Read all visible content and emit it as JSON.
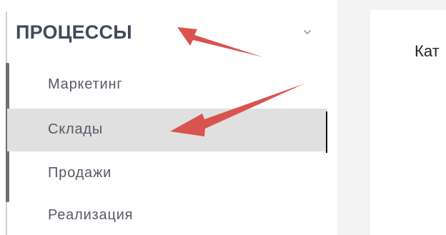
{
  "sidebar": {
    "section": {
      "title": "ПРОЦЕССЫ",
      "chevron": "chevron-down-icon"
    },
    "items": [
      {
        "label": "Маркетинг",
        "active": false
      },
      {
        "label": "Склады",
        "active": true
      },
      {
        "label": "Продажи",
        "active": false
      },
      {
        "label": "Реализация",
        "active": false
      }
    ]
  },
  "content": {
    "text": "Кат"
  },
  "colors": {
    "accent_arrow": "#d9534f",
    "active_bg": "#e0e0e0",
    "text": "#555b64",
    "header": "#3f4a5a"
  }
}
